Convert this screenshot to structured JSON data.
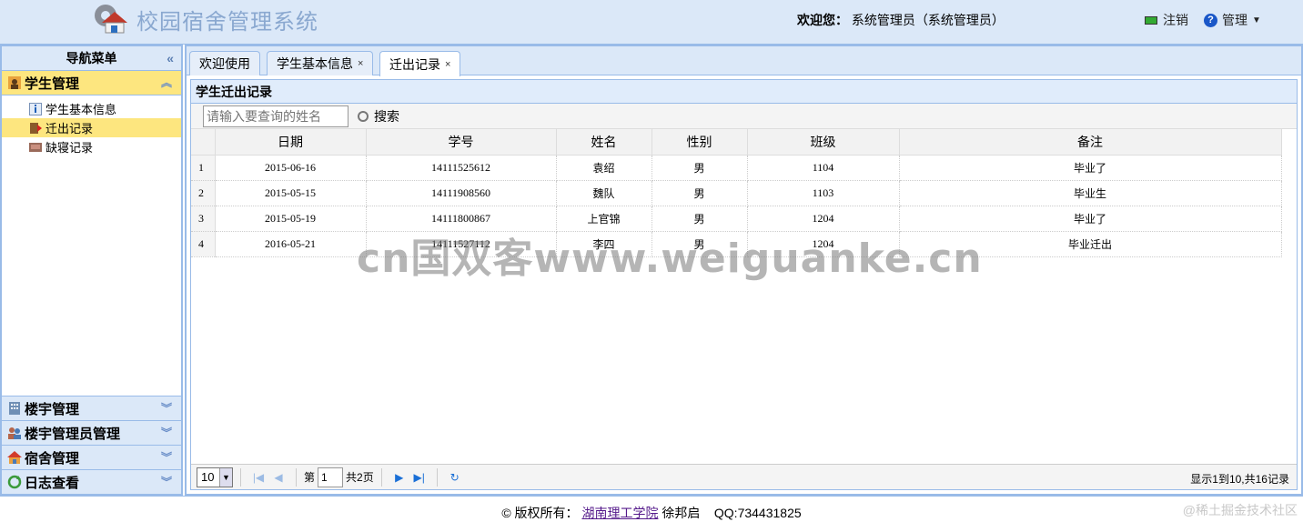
{
  "header": {
    "app_title": "校园宿舍管理系统",
    "welcome_label": "欢迎您：",
    "welcome_user": "系统管理员（系统管理员）",
    "logout": "注销",
    "admin": "管理"
  },
  "sidebar": {
    "title": "导航菜单",
    "groups": [
      {
        "label": "学生管理",
        "items": [
          {
            "label": "学生基本信息"
          },
          {
            "label": "迁出记录"
          },
          {
            "label": "缺寝记录"
          }
        ]
      },
      {
        "label": "楼宇管理"
      },
      {
        "label": "楼宇管理员管理"
      },
      {
        "label": "宿舍管理"
      },
      {
        "label": "日志查看"
      }
    ]
  },
  "tabs": [
    {
      "label": "欢迎使用"
    },
    {
      "label": "学生基本信息"
    },
    {
      "label": "迁出记录"
    }
  ],
  "panel": {
    "title": "学生迁出记录",
    "search_placeholder": "请输入要查询的姓名",
    "search_button": "搜索"
  },
  "table": {
    "columns": [
      "日期",
      "学号",
      "姓名",
      "性别",
      "班级",
      "备注"
    ],
    "rows": [
      {
        "n": "1",
        "date": "2015-06-16",
        "id": "14111525612",
        "name": "袁绍",
        "sex": "男",
        "class": "1104",
        "note": "毕业了"
      },
      {
        "n": "2",
        "date": "2015-05-15",
        "id": "14111908560",
        "name": "魏队",
        "sex": "男",
        "class": "1103",
        "note": "毕业生"
      },
      {
        "n": "3",
        "date": "2015-05-19",
        "id": "14111800867",
        "name": "上官锦",
        "sex": "男",
        "class": "1204",
        "note": "毕业了"
      },
      {
        "n": "4",
        "date": "2016-05-21",
        "id": "14111527112",
        "name": "李四",
        "sex": "男",
        "class": "1204",
        "note": "毕业迁出"
      }
    ]
  },
  "pager": {
    "page_size": "10",
    "page_prefix": "第",
    "page_value": "1",
    "page_total": "共2页",
    "info": "显示1到10,共16记录"
  },
  "footer": {
    "copyright": "© 版权所有：",
    "school": "湖南理工学院",
    "author": "徐邦启",
    "qq": "QQ:734431825"
  },
  "watermark": "cn国双客www.weiguanke.cn",
  "corner_watermark": "@稀土掘金技术社区"
}
